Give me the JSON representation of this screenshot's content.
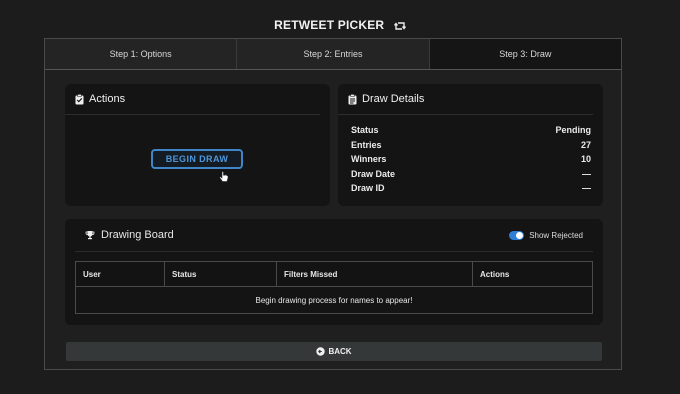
{
  "app": {
    "title": "RETWEET PICKER"
  },
  "tabs": [
    {
      "label": "Step 1: Options"
    },
    {
      "label": "Step 2: Entries"
    },
    {
      "label": "Step 3: Draw"
    }
  ],
  "actions": {
    "title": "Actions",
    "begin_label": "BEGIN DRAW"
  },
  "details": {
    "title": "Draw Details",
    "rows": [
      {
        "label": "Status",
        "value": "Pending"
      },
      {
        "label": "Entries",
        "value": "27"
      },
      {
        "label": "Winners",
        "value": "10"
      },
      {
        "label": "Draw Date",
        "value": "—"
      },
      {
        "label": "Draw ID",
        "value": "—"
      }
    ]
  },
  "board": {
    "title": "Drawing Board",
    "toggle_label": "Show Rejected",
    "toggle_on": true,
    "columns": [
      "User",
      "Status",
      "Filters Missed",
      "Actions"
    ],
    "empty_message": "Begin drawing process for names to appear!"
  },
  "back_label": "BACK",
  "colors": {
    "accent": "#3f86c9",
    "toggle": "#2f7fd6"
  }
}
